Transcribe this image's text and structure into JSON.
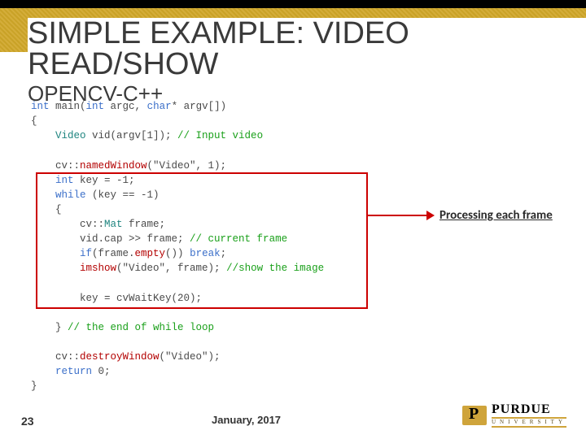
{
  "header": {
    "title": "SIMPLE EXAMPLE: VIDEO READ/SHOW",
    "subtitle": "OPENCV-C++"
  },
  "callout": {
    "label": "Processing each frame"
  },
  "code": {
    "l1a": "int",
    "l1b": " main(",
    "l1c": "int",
    "l1d": " argc, ",
    "l1e": "char",
    "l1f": "* argv[])",
    "l2": "{",
    "l3a": "    Video",
    "l3b": " vid(argv[1]); ",
    "l3c": "// Input video",
    "l5a": "    cv::",
    "l5b": "namedWindow",
    "l5c": "(\"Video\", 1);",
    "l6a": "    int",
    "l6b": " key = -1;",
    "l7a": "    while",
    "l7b": " (key == -1)",
    "l8": "    {",
    "l9a": "        cv::",
    "l9b": "Mat",
    "l9c": " frame;",
    "l10a": "        vid.cap >> frame; ",
    "l10b": "// current frame",
    "l11a": "        if",
    "l11b": "(frame.",
    "l11c": "empty",
    "l11d": "()) ",
    "l11e": "break",
    "l11f": ";",
    "l12a": "        imshow",
    "l12b": "(\"Video\", frame); ",
    "l12c": "//show the image",
    "l14": "        key = cvWaitKey(20);",
    "l16a": "    } ",
    "l16b": "// the end of while loop",
    "l18a": "    cv::",
    "l18b": "destroyWindow",
    "l18c": "(\"Video\");",
    "l19a": "    return",
    "l19b": " 0;",
    "l20": "}"
  },
  "footer": {
    "page": "23",
    "date": "January, 2017",
    "brand": "PURDUE",
    "brand_sub": "UNIVERSITY"
  }
}
